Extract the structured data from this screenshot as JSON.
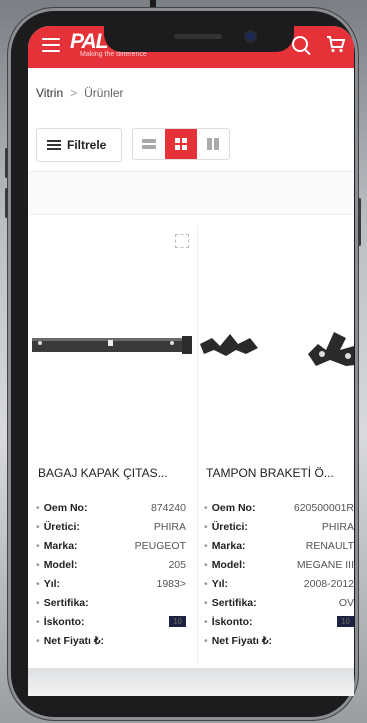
{
  "header": {
    "logo": "PAL",
    "tagline": "Making the difference",
    "brand_color": "#e53238"
  },
  "breadcrumb": {
    "home": "Vitrin",
    "separator": ">",
    "current": "Ürünler"
  },
  "toolbar": {
    "filter_label": "Filtrele",
    "view_modes": [
      "list-icon",
      "grid-icon",
      "columns-icon"
    ],
    "active_view": "grid"
  },
  "products": [
    {
      "name": "BAGAJ KAPAK ÇITAS...",
      "specs": [
        {
          "label": "Oem No:",
          "value": "874240"
        },
        {
          "label": "Üretici:",
          "value": "PHIRA"
        },
        {
          "label": "Marka:",
          "value": "PEUGEOT"
        },
        {
          "label": "Model:",
          "value": "205"
        },
        {
          "label": "Yıl:",
          "value": "1983>"
        },
        {
          "label": "Sertifika:",
          "value": ""
        },
        {
          "label": "İskonto:",
          "value": "10"
        },
        {
          "label": "Net Fiyatı ₺:",
          "value": ""
        }
      ]
    },
    {
      "name": "TAMPON BRAKETİ Ö...",
      "specs": [
        {
          "label": "Oem No:",
          "value": "620500001R"
        },
        {
          "label": "Üretici:",
          "value": "PHIRA"
        },
        {
          "label": "Marka:",
          "value": "RENAULT"
        },
        {
          "label": "Model:",
          "value": "MEGANE III"
        },
        {
          "label": "Yıl:",
          "value": "2008-2012"
        },
        {
          "label": "Sertifika:",
          "value": "OV"
        },
        {
          "label": "İskonto:",
          "value": "10"
        },
        {
          "label": "Net Fiyatı ₺:",
          "value": ""
        }
      ]
    }
  ]
}
